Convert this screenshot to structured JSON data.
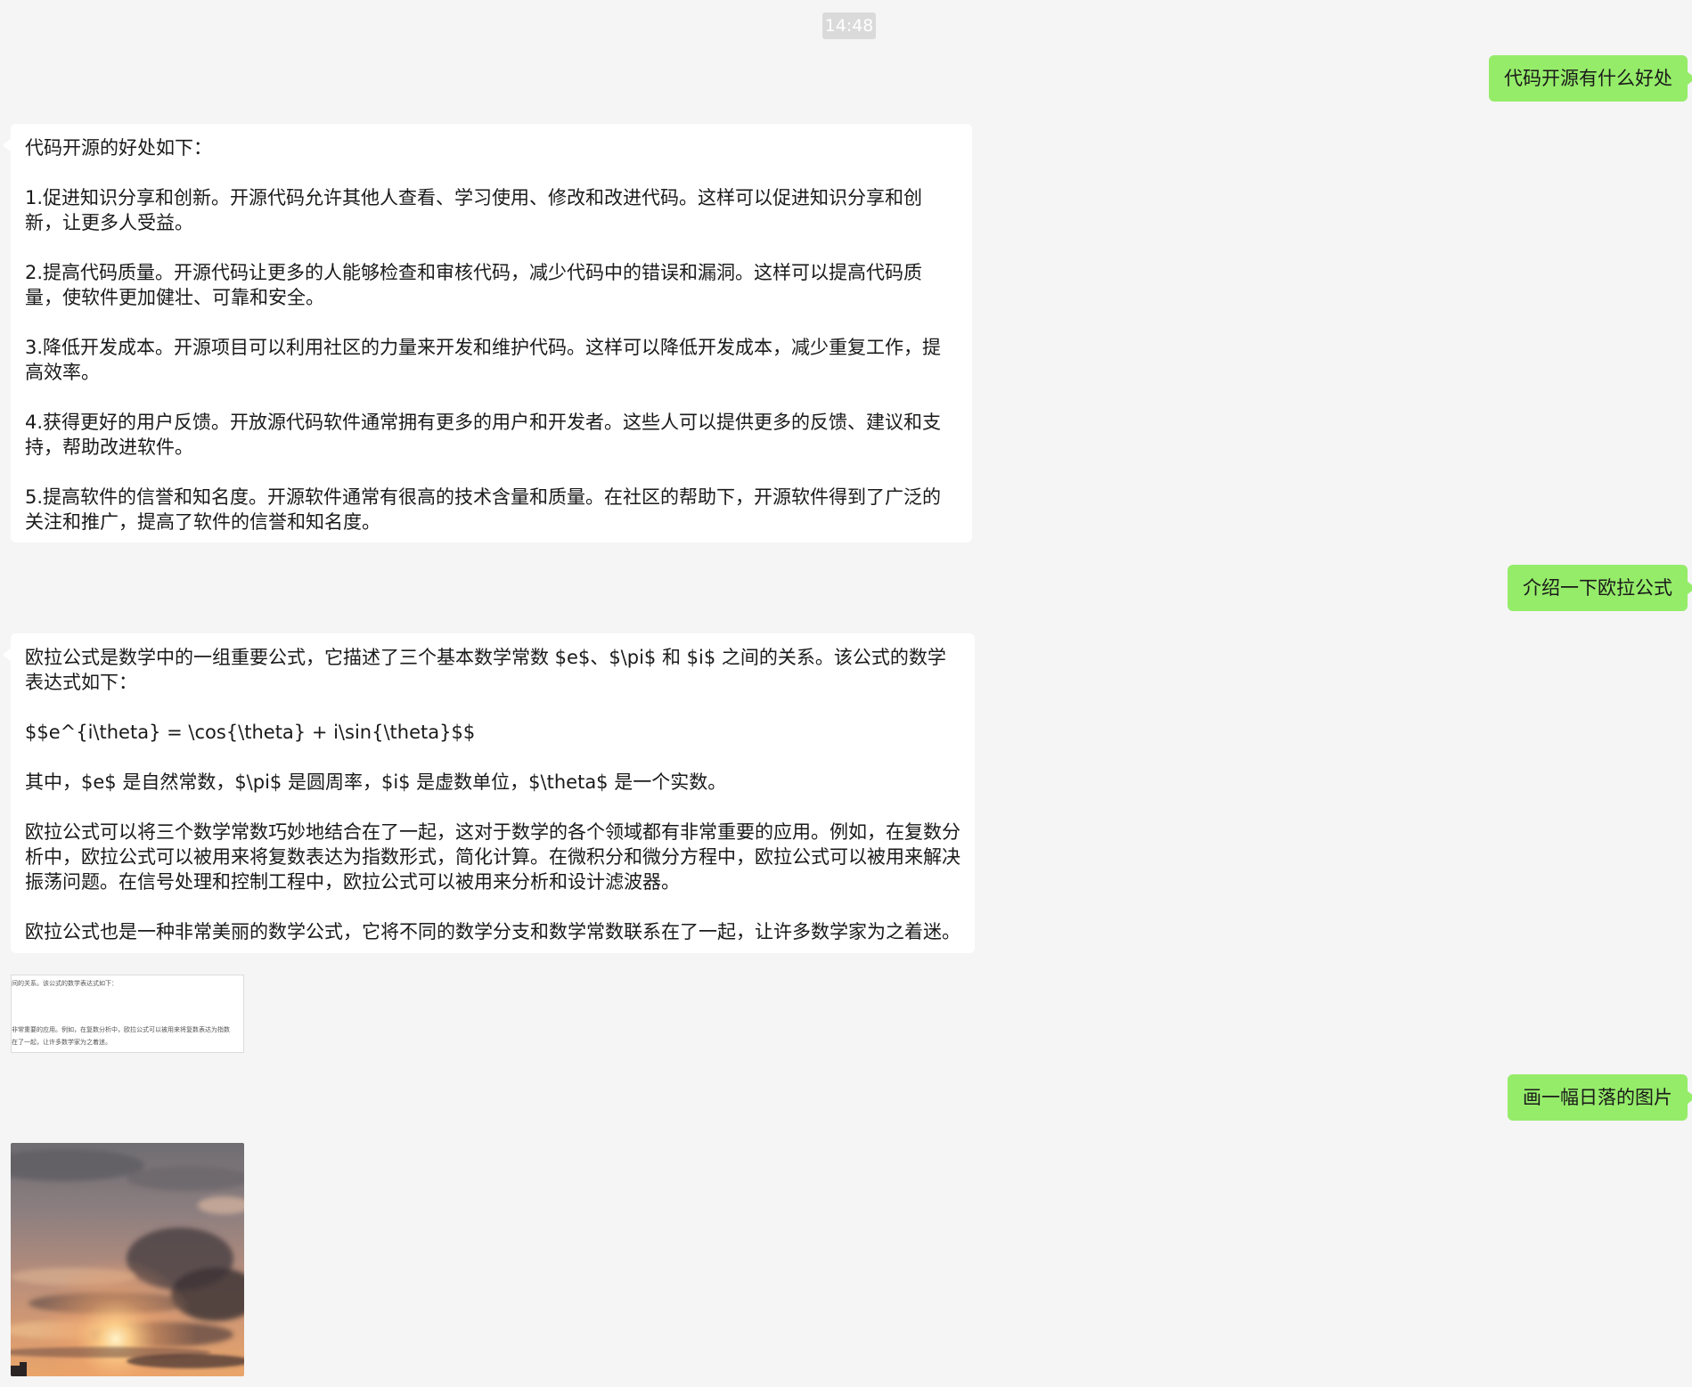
{
  "timestamp": "14:48",
  "messages": [
    {
      "role": "user",
      "text": "代码开源有什么好处"
    },
    {
      "role": "assistant",
      "paragraphs": [
        "代码开源的好处如下：",
        "1.促进知识分享和创新。开源代码允许其他人查看、学习使用、修改和改进代码。这样可以促进知识分享和创新，让更多人受益。",
        "2.提高代码质量。开源代码让更多的人能够检查和审核代码，减少代码中的错误和漏洞。这样可以提高代码质量，使软件更加健壮、可靠和安全。",
        "3.降低开发成本。开源项目可以利用社区的力量来开发和维护代码。这样可以降低开发成本，减少重复工作，提高效率。",
        "4.获得更好的用户反馈。开放源代码软件通常拥有更多的用户和开发者。这些人可以提供更多的反馈、建议和支持，帮助改进软件。",
        "5.提高软件的信誉和知名度。开源软件通常有很高的技术含量和质量。在社区的帮助下，开源软件得到了广泛的关注和推广，提高了软件的信誉和知名度。"
      ]
    },
    {
      "role": "user",
      "text": "介绍一下欧拉公式"
    },
    {
      "role": "assistant",
      "paragraphs": [
        "欧拉公式是数学中的一组重要公式，它描述了三个基本数学常数 $e$、$\\pi$ 和 $i$ 之间的关系。该公式的数学表达式如下：",
        "$$e^{i\\theta} = \\cos{\\theta} + i\\sin{\\theta}$$",
        "其中，$e$ 是自然常数，$\\pi$ 是圆周率，$i$ 是虚数单位，$\\theta$ 是一个实数。",
        "欧拉公式可以将三个数学常数巧妙地结合在了一起，这对于数学的各个领域都有非常重要的应用。例如，在复数分析中，欧拉公式可以被用来将复数表达为指数形式，简化计算。在微积分和微分方程中，欧拉公式可以被用来解决振荡问题。在信号处理和控制工程中，欧拉公式可以被用来分析和设计滤波器。",
        "欧拉公式也是一种非常美丽的数学公式，它将不同的数学分支和数学常数联系在了一起，让许多数学家为之着迷。"
      ]
    },
    {
      "role": "user",
      "text": "画一幅日落的图片"
    }
  ],
  "doc_thumbnail_lines": [
    "间的关系。该公式的数学表达式如下：",
    "非常重要的应用。例如，在复数分析中，欧拉公式可以被用来将复数表达为指数",
    "在了一起，让许多数学家为之着迷。"
  ],
  "colors": {
    "background": "#f5f5f5",
    "user_bubble": "#95ec69",
    "assistant_bubble": "#ffffff",
    "timestamp_bg": "#dadada"
  },
  "icons": {
    "doc_thumbnail": "document-screenshot-image",
    "sunset_image": "sunset-photo-image"
  }
}
